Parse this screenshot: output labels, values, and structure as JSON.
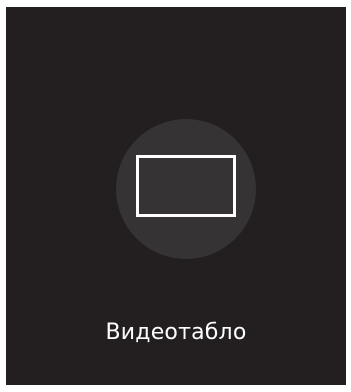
{
  "tile": {
    "label": "Видеотабло",
    "icon": "video-wall-screen-icon"
  },
  "colors": {
    "tile_background": "#231f20",
    "icon_circle": "#363334",
    "icon_stroke": "#ffffff",
    "label_text": "#ffffff"
  }
}
